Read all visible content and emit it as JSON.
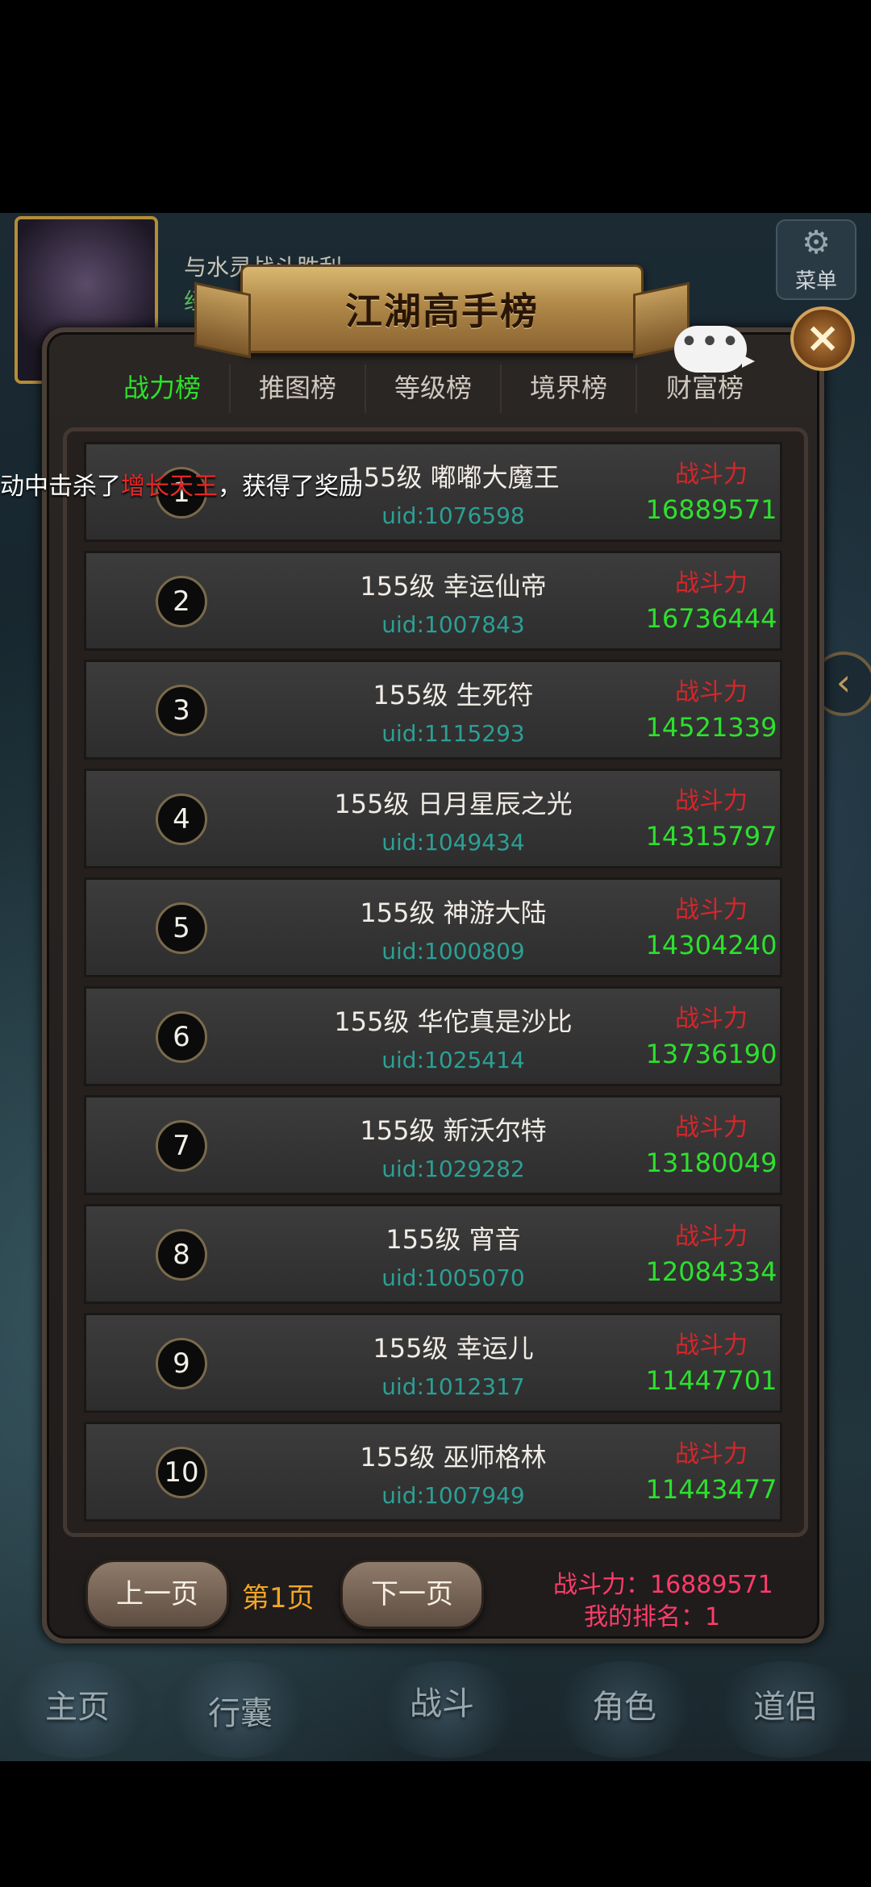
{
  "hud": {
    "quest_text": "与水灵战斗胜利",
    "exp_label": "经验",
    "menu_label": "菜单"
  },
  "panel": {
    "title": "江湖高手榜",
    "close_icon": "close-icon"
  },
  "tabs": [
    {
      "label": "战力榜",
      "active": true
    },
    {
      "label": "推图榜",
      "active": false
    },
    {
      "label": "等级榜",
      "active": false
    },
    {
      "label": "境界榜",
      "active": false
    },
    {
      "label": "财富榜",
      "active": false
    }
  ],
  "overlay_message": {
    "prefix": "动中击杀了",
    "highlight": "增长天王",
    "suffix": "，获得了奖励"
  },
  "leaderboard": {
    "power_label": "战斗力",
    "rows": [
      {
        "rank": "1",
        "name": "155级 嘟嘟大魔王",
        "uid": "uid:1076598",
        "power": "16889571"
      },
      {
        "rank": "2",
        "name": "155级 幸运仙帝",
        "uid": "uid:1007843",
        "power": "16736444"
      },
      {
        "rank": "3",
        "name": "155级 生死符",
        "uid": "uid:1115293",
        "power": "14521339"
      },
      {
        "rank": "4",
        "name": "155级 日月星辰之光",
        "uid": "uid:1049434",
        "power": "14315797"
      },
      {
        "rank": "5",
        "name": "155级 神游大陆",
        "uid": "uid:1000809",
        "power": "14304240"
      },
      {
        "rank": "6",
        "name": "155级 华佗真是沙比",
        "uid": "uid:1025414",
        "power": "13736190"
      },
      {
        "rank": "7",
        "name": "155级 新沃尔特",
        "uid": "uid:1029282",
        "power": "13180049"
      },
      {
        "rank": "8",
        "name": "155级 宵音",
        "uid": "uid:1005070",
        "power": "12084334"
      },
      {
        "rank": "9",
        "name": "155级 幸运儿",
        "uid": "uid:1012317",
        "power": "11447701"
      },
      {
        "rank": "10",
        "name": "155级 巫师格林",
        "uid": "uid:1007949",
        "power": "11443477"
      }
    ]
  },
  "footer": {
    "prev_label": "上一页",
    "page_label": "第1页",
    "next_label": "下一页",
    "my_power": "战斗力：16889571",
    "my_rank": "我的排名：1"
  },
  "bottom_nav": [
    {
      "label": "主页"
    },
    {
      "label": "行囊"
    },
    {
      "label": "战斗"
    },
    {
      "label": "角色"
    },
    {
      "label": "道侣"
    }
  ]
}
